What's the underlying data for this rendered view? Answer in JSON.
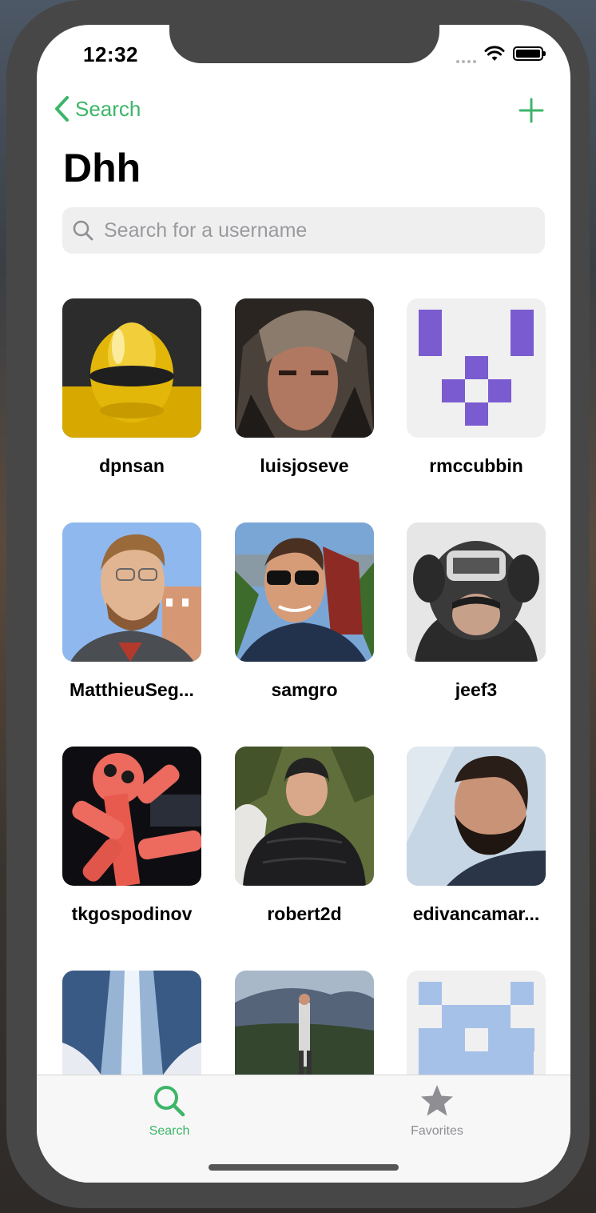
{
  "status": {
    "time": "12:32"
  },
  "nav": {
    "back_label": "Search",
    "title": "Dhh"
  },
  "search": {
    "placeholder": "Search for a username",
    "value": ""
  },
  "users": [
    {
      "username": "dpnsan"
    },
    {
      "username": "luisjoseve"
    },
    {
      "username": "rmccubbin"
    },
    {
      "username": "MatthieuSeg..."
    },
    {
      "username": "samgro"
    },
    {
      "username": "jeef3"
    },
    {
      "username": "tkgospodinov"
    },
    {
      "username": "robert2d"
    },
    {
      "username": "edivancamar..."
    },
    {
      "username": ""
    },
    {
      "username": ""
    },
    {
      "username": ""
    }
  ],
  "tabs": [
    {
      "label": "Search",
      "icon": "search-icon",
      "active": true
    },
    {
      "label": "Favorites",
      "icon": "star-icon",
      "active": false
    }
  ],
  "colors": {
    "accent": "#3db569",
    "inactive": "#8e8e93"
  }
}
